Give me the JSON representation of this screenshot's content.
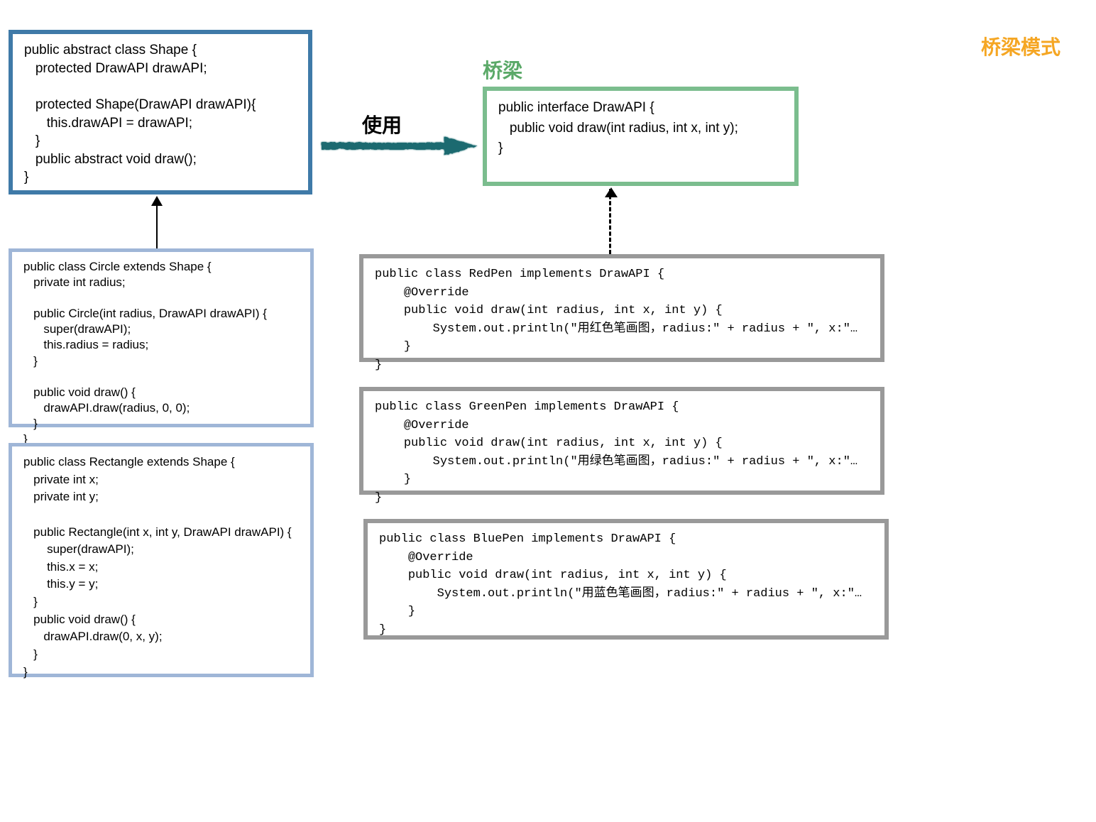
{
  "labels": {
    "title": "桥梁模式",
    "bridge": "桥梁",
    "use": "使用"
  },
  "code": {
    "shape": "public abstract class Shape {\n   protected DrawAPI drawAPI;\n\n   protected Shape(DrawAPI drawAPI){\n      this.drawAPI = drawAPI;\n   }\n   public abstract void draw();\n}",
    "drawapi": "public interface DrawAPI {\n   public void draw(int radius, int x, int y);\n}",
    "circle": "public class Circle extends Shape {\n   private int radius;\n\n   public Circle(int radius, DrawAPI drawAPI) {\n      super(drawAPI);\n      this.radius = radius;\n   }\n\n   public void draw() {\n      drawAPI.draw(radius, 0, 0);\n   }\n}",
    "rectangle": "public class Rectangle extends Shape {\n   private int x;\n   private int y;\n\n   public Rectangle(int x, int y, DrawAPI drawAPI) {\n       super(drawAPI);\n       this.x = x;\n       this.y = y;\n   }\n   public void draw() {\n      drawAPI.draw(0, x, y);\n   }\n}",
    "redpen": "public class RedPen implements DrawAPI {\n    @Override\n    public void draw(int radius, int x, int y) {\n        System.out.println(\"用红色笔画图，radius:\" + radius + \", x:\"…\n    }\n}",
    "greenpen": "public class GreenPen implements DrawAPI {\n    @Override\n    public void draw(int radius, int x, int y) {\n        System.out.println(\"用绿色笔画图，radius:\" + radius + \", x:\"…\n    }\n}",
    "bluepen": "public class BluePen implements DrawAPI {\n    @Override\n    public void draw(int radius, int x, int y) {\n        System.out.println(\"用蓝色笔画图，radius:\" + radius + \", x:\"…\n    }\n}"
  },
  "colors": {
    "shape_border": "#3f7aa8",
    "drawapi_border": "#7bbd8e",
    "subclass_border": "#9fb6d7",
    "pen_border": "#999",
    "title_color": "#f5a623",
    "bridge_label_color": "#5ba968",
    "arrow_use_color": "#1a6b6f"
  }
}
